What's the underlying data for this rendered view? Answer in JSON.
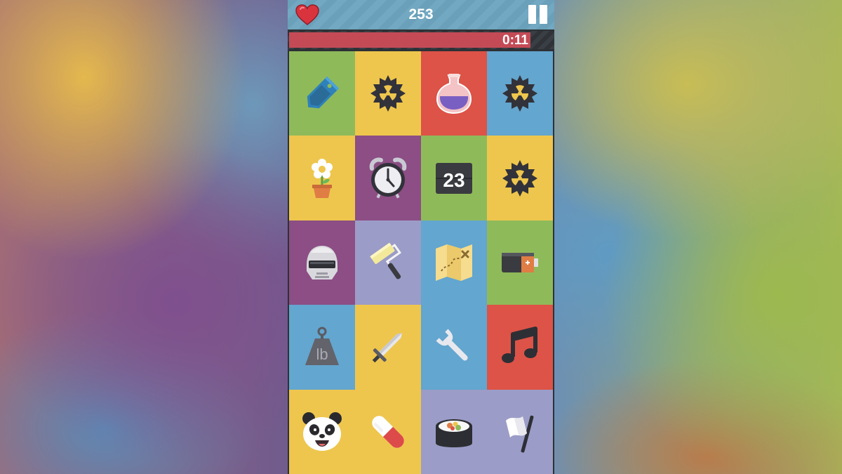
{
  "header": {
    "score": "253",
    "timer": "0:11",
    "timer_remaining_fraction": 0.92
  },
  "colors": {
    "green": "#8fba5a",
    "yellow": "#eec64d",
    "red": "#dd5347",
    "blue": "#63a6cf",
    "purple": "#8c4e84",
    "lavender": "#9b9cc7"
  },
  "board": {
    "tiles": [
      {
        "icon": "price-tag-icon",
        "color": "#8fba5a"
      },
      {
        "icon": "radioactive-mine-icon",
        "color": "#eec64d"
      },
      {
        "icon": "potion-flask-icon",
        "color": "#dd5347"
      },
      {
        "icon": "radioactive-mine-icon",
        "color": "#63a6cf"
      },
      {
        "icon": "potted-flower-icon",
        "color": "#eec64d"
      },
      {
        "icon": "alarm-clock-icon",
        "color": "#8c4e84"
      },
      {
        "icon": "calendar-icon",
        "color": "#8fba5a",
        "text": "23"
      },
      {
        "icon": "radioactive-mine-icon",
        "color": "#eec64d"
      },
      {
        "icon": "robot-helmet-icon",
        "color": "#8c4e84"
      },
      {
        "icon": "paint-roller-icon",
        "color": "#9b9cc7"
      },
      {
        "icon": "treasure-map-icon",
        "color": "#63a6cf"
      },
      {
        "icon": "battery-icon",
        "color": "#8fba5a"
      },
      {
        "icon": "weight-icon",
        "color": "#63a6cf",
        "text": "lb"
      },
      {
        "icon": "sword-icon",
        "color": "#eec64d"
      },
      {
        "icon": "wrench-icon",
        "color": "#63a6cf"
      },
      {
        "icon": "music-note-icon",
        "color": "#dd5347"
      },
      {
        "icon": "panda-icon",
        "color": "#eec64d"
      },
      {
        "icon": "pill-icon",
        "color": "#eec64d"
      },
      {
        "icon": "sushi-roll-icon",
        "color": "#9b9cc7"
      },
      {
        "icon": "white-flag-icon",
        "color": "#9b9cc7"
      }
    ]
  }
}
